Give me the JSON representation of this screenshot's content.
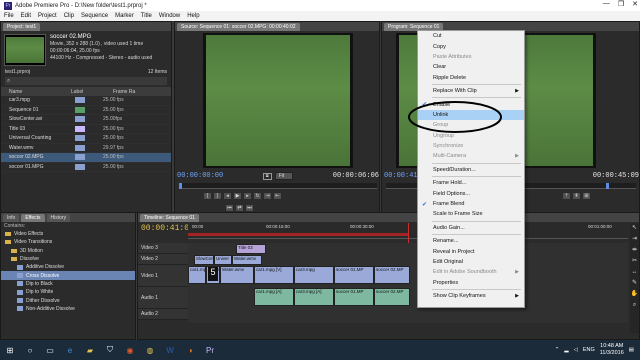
{
  "window": {
    "title": "Adobe Premiere Pro - D:\\New folder\\test1.prproj *",
    "controls": [
      "—",
      "❐",
      "✕"
    ]
  },
  "menu": [
    "File",
    "Edit",
    "Project",
    "Clip",
    "Sequence",
    "Marker",
    "Title",
    "Window",
    "Help"
  ],
  "project": {
    "tab": "Project: test1",
    "clip_name": "soccer 02.MPG",
    "clip_info": [
      "Movie, 352 x 288 (1.0) , video used 1 time",
      "00:00:06:04, 25.00 fps",
      "44100 Hz - Compressed - Stereo - audio used"
    ],
    "file": "test1.prproj",
    "count": "12 Items",
    "columns": [
      "Name",
      "Label",
      "Frame Ra"
    ],
    "items": [
      {
        "name": "car3.mpg",
        "label_color": "#8aa0d0",
        "rate": "25.00 fps",
        "selected": false
      },
      {
        "name": "Sequence 01",
        "label_color": "#58a06a",
        "rate": "25.00 fps",
        "selected": false
      },
      {
        "name": "SlowCenter.avi",
        "label_color": "#8aa0d0",
        "rate": "25.00fps",
        "selected": false
      },
      {
        "name": "Title 03",
        "label_color": "#c9b8ff",
        "rate": "25.00 fps",
        "selected": false
      },
      {
        "name": "Universal Counting Leader",
        "label_color": "#8aa0d0",
        "rate": "25.00 fps",
        "selected": false
      },
      {
        "name": "Water.wmv",
        "label_color": "#8aa0d0",
        "rate": "29.97 fps",
        "selected": false
      },
      {
        "name": "soccer 02.MPG",
        "label_color": "#8aa0d0",
        "rate": "25.00 fps",
        "selected": true
      },
      {
        "name": "soccer 01.MPG",
        "label_color": "#8aa0d0",
        "rate": "25.00 fps",
        "selected": false
      }
    ]
  },
  "source": {
    "tab": "Source: Sequence 01: soccer 02.MPG: 00:00:40:02",
    "tc_in": "00:00:00:00",
    "fit": "Fit",
    "tc_dur": "00:00:06:06"
  },
  "program": {
    "tab": "Program: Sequence 01",
    "tc_in": "00:00:41:0",
    "tc_dur": "00:00:45:09"
  },
  "effects": {
    "tabs": [
      "Info",
      "Effects",
      "History"
    ],
    "contains": "Contains:",
    "tree": [
      {
        "label": "Video Effects",
        "type": "folder",
        "indent": 0,
        "selected": false
      },
      {
        "label": "Video Transitions",
        "type": "folder",
        "indent": 0,
        "selected": false
      },
      {
        "label": "3D Motion",
        "type": "folder",
        "indent": 1,
        "selected": false
      },
      {
        "label": "Dissolve",
        "type": "folder",
        "indent": 1,
        "selected": false
      },
      {
        "label": "Additive Dissolve",
        "type": "item",
        "indent": 2,
        "selected": false
      },
      {
        "label": "Cross Dissolve",
        "type": "item",
        "indent": 2,
        "selected": true
      },
      {
        "label": "Dip to Black",
        "type": "item",
        "indent": 2,
        "selected": false
      },
      {
        "label": "Dip to White",
        "type": "item",
        "indent": 2,
        "selected": false
      },
      {
        "label": "Dither Dissolve",
        "type": "item",
        "indent": 2,
        "selected": false
      },
      {
        "label": "Non-Additive Dissolve",
        "type": "item",
        "indent": 2,
        "selected": false
      }
    ]
  },
  "timeline": {
    "tab": "Timeline: Sequence 01",
    "tc": "00:00:41:04",
    "ruler": [
      "00:00",
      "00:00:15:00",
      "00:00:30:00",
      "00:00:45:00",
      "00:01:00:00"
    ],
    "tracks": [
      "Video 3",
      "Video 2",
      "Video 1",
      "Audio 1",
      "Audio 2"
    ],
    "clips": {
      "title": "Title 03",
      "v2": [
        "SlowCen",
        "Univer",
        "Water.wmv"
      ],
      "v1": [
        "car1.mpg",
        "Univer",
        "Water.wmv",
        "car1.mpg [V]",
        "car3.mpg",
        "soccer 01.MP",
        "soccer 02.MP"
      ],
      "a1": [
        "car1.mpg [A]",
        "car3.mpg [A]",
        "soccer 01.MP",
        "soccer 02.MP"
      ],
      "counter": "5",
      "opacity": "Opacity:Opacity"
    }
  },
  "context_menu": [
    {
      "label": "Cut",
      "state": "normal"
    },
    {
      "label": "Copy",
      "state": "normal"
    },
    {
      "label": "Paste Attributes",
      "state": "disabled"
    },
    {
      "label": "Clear",
      "state": "normal"
    },
    {
      "label": "Ripple Delete",
      "state": "normal"
    },
    {
      "sep": true
    },
    {
      "label": "Replace With Clip",
      "state": "normal",
      "submenu": true
    },
    {
      "sep": true
    },
    {
      "label": "Enable",
      "state": "normal",
      "checked": true
    },
    {
      "label": "Unlink",
      "state": "highlight"
    },
    {
      "label": "Group",
      "state": "disabled"
    },
    {
      "label": "Ungroup",
      "state": "disabled"
    },
    {
      "label": "Synchronize",
      "state": "disabled"
    },
    {
      "label": "Multi-Camera",
      "state": "disabled",
      "submenu": true
    },
    {
      "sep": true
    },
    {
      "label": "Speed/Duration...",
      "state": "normal"
    },
    {
      "sep": true
    },
    {
      "label": "Frame Hold...",
      "state": "normal"
    },
    {
      "label": "Field Options...",
      "state": "normal"
    },
    {
      "label": "Frame Blend",
      "state": "normal",
      "checked": true
    },
    {
      "label": "Scale to Frame Size",
      "state": "normal"
    },
    {
      "sep": true
    },
    {
      "label": "Audio Gain...",
      "state": "normal"
    },
    {
      "sep": true
    },
    {
      "label": "Rename...",
      "state": "normal"
    },
    {
      "label": "Reveal in Project",
      "state": "normal"
    },
    {
      "label": "Edit Original",
      "state": "normal"
    },
    {
      "label": "Edit in Adobe Soundbooth",
      "state": "disabled",
      "submenu": true
    },
    {
      "label": "Properties",
      "state": "normal"
    },
    {
      "sep": true
    },
    {
      "label": "Show Clip Keyframes",
      "state": "normal",
      "submenu": true
    }
  ],
  "taskbar": {
    "lang": "ENG",
    "time": "10:48 AM",
    "date": "11/3/2016"
  }
}
